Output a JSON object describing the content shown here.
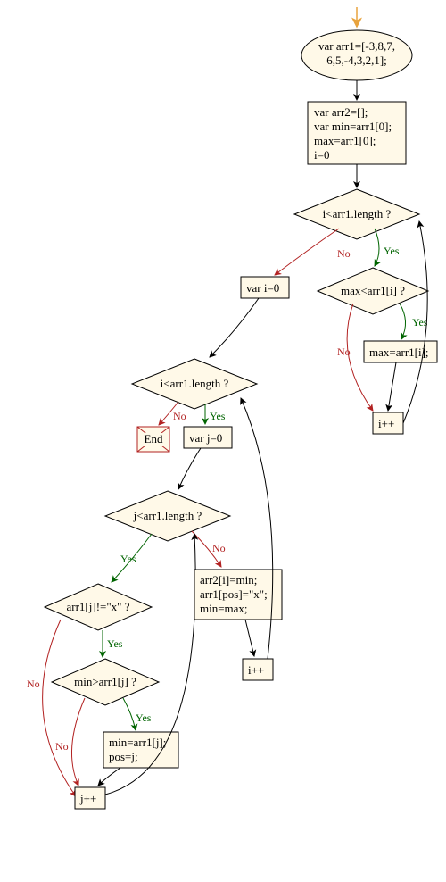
{
  "nodes": {
    "start_arrow": {
      "type": "start"
    },
    "n1": {
      "type": "ellipse",
      "lines": [
        "var arr1=[-3,8,7,",
        "6,5,-4,3,2,1];"
      ]
    },
    "n2": {
      "type": "box",
      "lines": [
        "var arr2=[];",
        "var min=arr1[0];",
        "max=arr1[0];",
        "i=0"
      ]
    },
    "n3": {
      "type": "diamond",
      "lines": [
        "i<arr1.length ?"
      ]
    },
    "n4": {
      "type": "diamond",
      "lines": [
        "max<arr1[i] ?"
      ]
    },
    "n5": {
      "type": "box",
      "lines": [
        "max=arr1[i];"
      ]
    },
    "n6": {
      "type": "box",
      "lines": [
        "i++"
      ]
    },
    "n7": {
      "type": "box",
      "lines": [
        "var i=0"
      ]
    },
    "n8": {
      "type": "diamond",
      "lines": [
        "i<arr1.length ?"
      ]
    },
    "n9": {
      "type": "box",
      "lines": [
        "var j=0"
      ]
    },
    "n10": {
      "type": "end",
      "lines": [
        "End"
      ]
    },
    "n11": {
      "type": "diamond",
      "lines": [
        "j<arr1.length ?"
      ]
    },
    "n12": {
      "type": "diamond",
      "lines": [
        "arr1[j]!=\"x\" ?"
      ]
    },
    "n13": {
      "type": "diamond",
      "lines": [
        "min>arr1[j] ?"
      ]
    },
    "n14": {
      "type": "box",
      "lines": [
        "min=arr1[j];",
        "pos=j;"
      ]
    },
    "n15": {
      "type": "box",
      "lines": [
        "j++"
      ]
    },
    "n16": {
      "type": "box",
      "lines": [
        "arr2[i]=min;",
        "arr1[pos]=\"x\";",
        "min=max;"
      ]
    },
    "n17": {
      "type": "box",
      "lines": [
        "i++"
      ]
    }
  },
  "edge_labels": {
    "yes": "Yes",
    "no": "No"
  }
}
